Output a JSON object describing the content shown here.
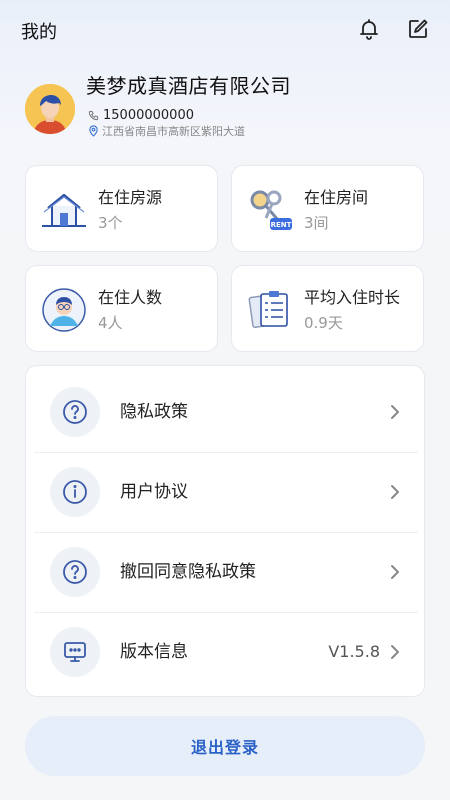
{
  "header": {
    "title": "我的",
    "bell_icon": "bell-icon",
    "edit_icon": "edit-icon"
  },
  "profile": {
    "company": "美梦成真酒店有限公司",
    "phone": "15000000000",
    "address": "江西省南昌市高新区紫阳大道",
    "avatar_icon": "user-avatar"
  },
  "stats": [
    {
      "label": "在住房源",
      "value": "3个",
      "icon": "house-icon"
    },
    {
      "label": "在住房间",
      "value": "3间",
      "icon": "keys-icon",
      "tag": "RENT"
    },
    {
      "label": "在住人数",
      "value": "4人",
      "icon": "person-icon"
    },
    {
      "label": "平均入住时长",
      "value": "0.9天",
      "icon": "clipboard-icon"
    }
  ],
  "menu": [
    {
      "label": "隐私政策",
      "icon": "question-icon"
    },
    {
      "label": "用户协议",
      "icon": "info-icon"
    },
    {
      "label": "撤回同意隐私政策",
      "icon": "question-icon"
    },
    {
      "label": "版本信息",
      "value": "V1.5.8",
      "icon": "monitor-icon"
    }
  ],
  "logout_label": "退出登录",
  "colors": {
    "accent": "#2b62c8",
    "icon_blue": "#3a5aa8",
    "logout_bg": "#e6eef9"
  }
}
